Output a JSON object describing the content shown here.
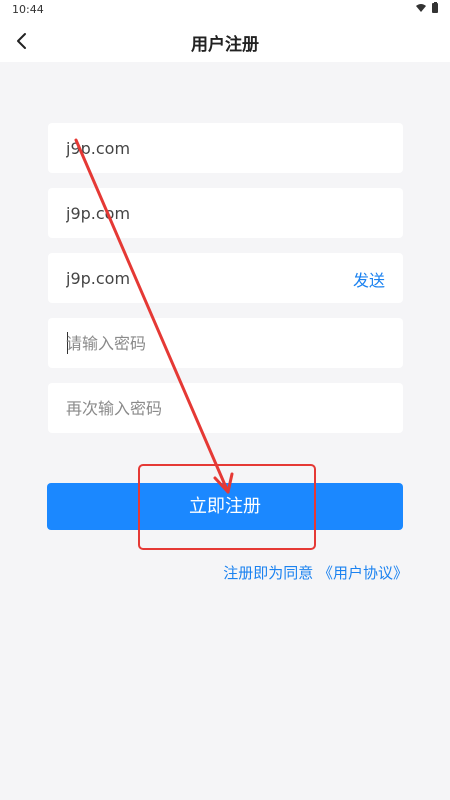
{
  "status_bar": {
    "time": "10:44"
  },
  "header": {
    "title": "用户注册"
  },
  "form": {
    "field1_value": "j9p.com",
    "field2_value": "j9p.com",
    "field3_value": "j9p.com",
    "send_label": "发送",
    "password_placeholder": "请输入密码",
    "confirm_password_placeholder": "再次输入密码",
    "register_label": "立即注册"
  },
  "agreement": {
    "prefix": "注册即为同意",
    "link": "《用户协议》"
  },
  "colors": {
    "accent": "#1b88ff",
    "link": "#1b82f0",
    "annotation": "#e53935",
    "background": "#f5f5f7"
  }
}
